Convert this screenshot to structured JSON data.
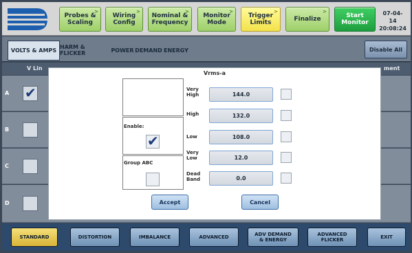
{
  "wizard": {
    "steps": [
      {
        "label": "Probes &\nScaling"
      },
      {
        "label": "Wiring\nConfig"
      },
      {
        "label": "Nominal &\nFrequency"
      },
      {
        "label": "Monitor\nMode"
      },
      {
        "label": "Trigger\nLimits"
      },
      {
        "label": "Finalize"
      },
      {
        "label": "Start\nMonitor"
      }
    ],
    "date": "07-04-14",
    "time": "20:08:24"
  },
  "tabs": {
    "items": [
      {
        "label": "VOLTS & AMPS"
      },
      {
        "label": "HARM & FLICKER"
      },
      {
        "label": "POWER"
      },
      {
        "label": "DEMAND"
      },
      {
        "label": "ENERGY"
      }
    ],
    "disable_all": "Disable All"
  },
  "grid": {
    "col_left": "V Lin",
    "col_right": "ment",
    "rows": [
      {
        "label": "A",
        "checked": true
      },
      {
        "label": "B",
        "checked": false
      },
      {
        "label": "C",
        "checked": false
      },
      {
        "label": "D",
        "checked": false
      }
    ]
  },
  "dialog": {
    "title": "Vrms-a",
    "enable_label": "Enable:",
    "enable_checked": true,
    "group_label": "Group ABC",
    "group_checked": false,
    "limits": [
      {
        "label": "Very\nHigh",
        "value": "144.0"
      },
      {
        "label": "High",
        "value": "132.0"
      },
      {
        "label": "Low",
        "value": "108.0"
      },
      {
        "label": "Very\nLow",
        "value": "12.0"
      },
      {
        "label": "Dead\nBand",
        "value": "0.0"
      }
    ],
    "accept": "Accept",
    "cancel": "Cancel"
  },
  "bottom_nav": {
    "items": [
      {
        "label": "STANDARD"
      },
      {
        "label": "DISTORTION"
      },
      {
        "label": "IMBALANCE"
      },
      {
        "label": "ADVANCED"
      },
      {
        "label": "ADV DEMAND\n& ENERGY"
      },
      {
        "label": "ADVANCED\nFLICKER"
      },
      {
        "label": "EXIT"
      }
    ]
  },
  "colors": {
    "wizard_green": "#9fd06a",
    "wizard_active": "#f3e24a",
    "start_green": "#1e9e3e",
    "selected_nav": "#d7b437"
  }
}
